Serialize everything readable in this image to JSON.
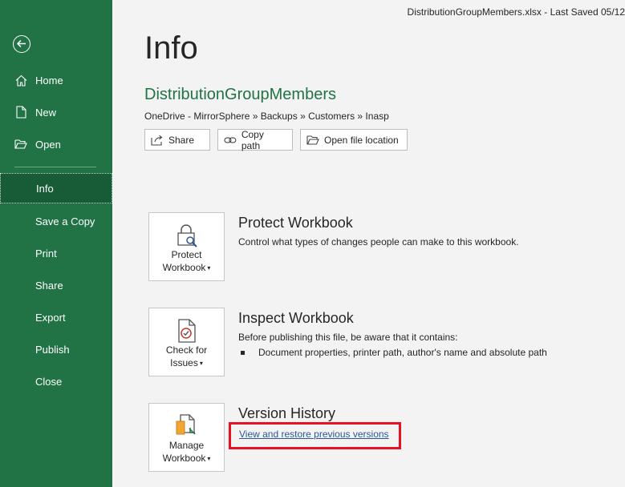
{
  "window": {
    "title_status": "DistributionGroupMembers.xlsx  -  Last Saved 05/12"
  },
  "sidebar": {
    "back_icon": "back-arrow-icon",
    "items": [
      {
        "label": "Home",
        "icon": "home-icon"
      },
      {
        "label": "New",
        "icon": "new-file-icon"
      },
      {
        "label": "Open",
        "icon": "open-folder-icon"
      },
      {
        "label": "Info",
        "active": true
      },
      {
        "label": "Save a Copy"
      },
      {
        "label": "Print"
      },
      {
        "label": "Share"
      },
      {
        "label": "Export"
      },
      {
        "label": "Publish"
      },
      {
        "label": "Close"
      }
    ]
  },
  "main": {
    "title": "Info",
    "file_name": "DistributionGroupMembers",
    "file_path": "OneDrive - MirrorSphere » Backups » Customers » Inasp",
    "buttons": {
      "share": "Share",
      "copy_path": "Copy path",
      "open_location": "Open file location"
    },
    "protect": {
      "card_line1": "Protect",
      "card_line2": "Workbook",
      "title": "Protect Workbook",
      "desc": "Control what types of changes people can make to this workbook."
    },
    "inspect": {
      "card_line1": "Check for",
      "card_line2": "Issues",
      "title": "Inspect Workbook",
      "desc": "Before publishing this file, be aware that it contains:",
      "bullet": "Document properties, printer path, author's name and absolute path"
    },
    "version": {
      "card_line1": "Manage",
      "card_line2": "Workbook",
      "title": "Version History",
      "link": "View and restore previous versions"
    }
  },
  "colors": {
    "brand": "#217346",
    "active_nav": "#185c37",
    "link": "#2b579a",
    "highlight": "#e81123"
  }
}
